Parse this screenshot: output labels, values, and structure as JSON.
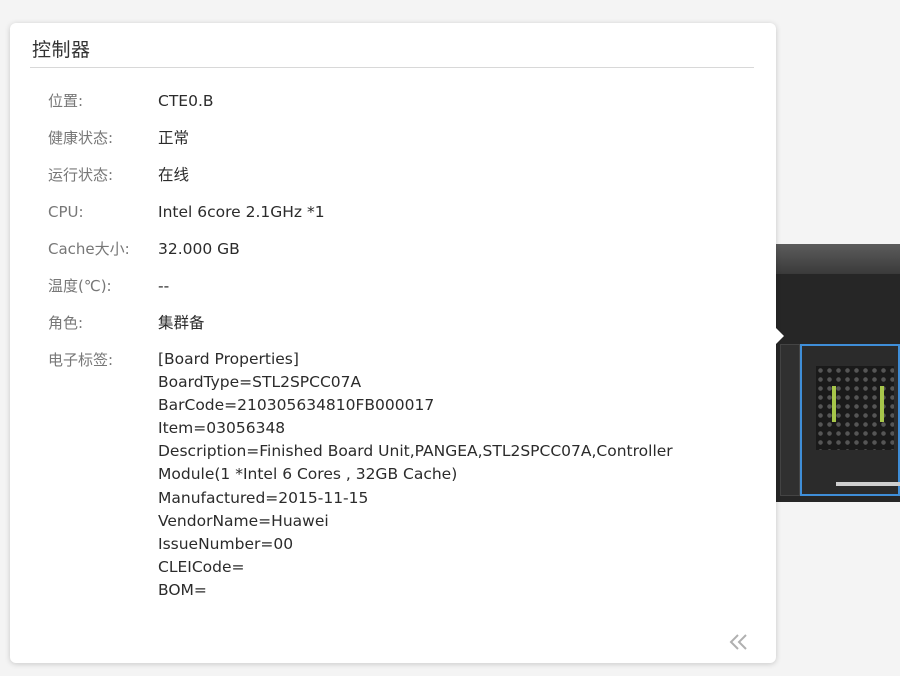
{
  "panel": {
    "title": "控制器",
    "collapse_icon": "double-chevron-left-icon"
  },
  "fields": [
    {
      "label": "位置:",
      "value": "CTE0.B"
    },
    {
      "label": "健康状态:",
      "value": "正常"
    },
    {
      "label": "运行状态:",
      "value": "在线"
    },
    {
      "label": "CPU:",
      "value": "Intel 6core 2.1GHz *1"
    },
    {
      "label": "Cache大小:",
      "value": "32.000 GB"
    },
    {
      "label": "温度(℃):",
      "value": "--"
    },
    {
      "label": "角色:",
      "value": "集群备"
    }
  ],
  "elabel": {
    "label": "电子标签:",
    "lines": [
      "[Board Properties]",
      "BoardType=STL2SPCC07A",
      "BarCode=210305634810FB000017",
      "Item=03056348",
      "Description=Finished Board Unit,PANGEA,STL2SPCC07A,Controller",
      "Module(1 *Intel 6 Cores , 32GB Cache)",
      "Manufactured=2015-11-15",
      "VendorName=Huawei",
      "IssueNumber=00",
      "CLEICode=",
      "BOM="
    ]
  },
  "colors": {
    "module_highlight": "#3f8ed8",
    "led": "#a7c64a"
  }
}
